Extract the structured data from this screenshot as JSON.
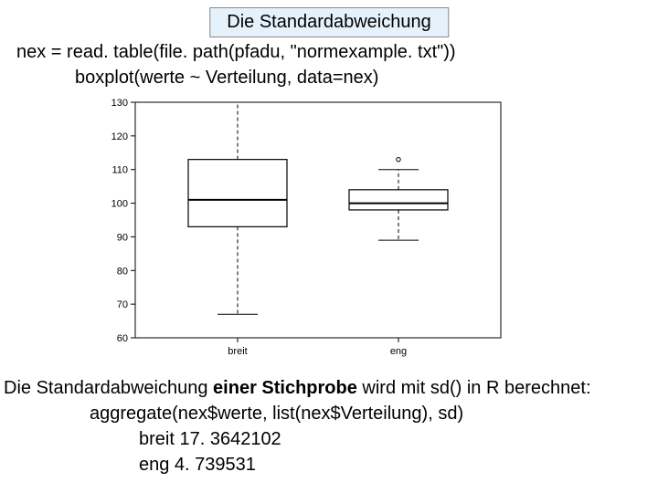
{
  "title": "Die Standardabweichung",
  "code": {
    "line1": "nex = read. table(file. path(pfadu, \"normexample. txt\"))",
    "line2": "boxplot(werte ~ Verteilung, data=nex)"
  },
  "below": {
    "line1_a": "Die Standardabweichung ",
    "line1_b": "einer Stichprobe",
    "line1_c": " wird mit sd() in R berechnet:",
    "line2": "aggregate(nex$werte, list(nex$Verteilung), sd)",
    "line3": "breit    17. 3642102",
    "line4": "eng                 4. 739531"
  },
  "chart_data": {
    "type": "boxplot",
    "title": "",
    "xlabel": "",
    "ylabel": "",
    "ylim": [
      60,
      130
    ],
    "yticks": [
      60,
      70,
      80,
      90,
      100,
      110,
      120,
      130
    ],
    "categories": [
      "breit",
      "eng"
    ],
    "series": [
      {
        "name": "breit",
        "min": 67,
        "q1": 93,
        "median": 101,
        "q3": 113,
        "max": 130
      },
      {
        "name": "eng",
        "min": 89,
        "q1": 98,
        "median": 100,
        "q3": 104,
        "max": 110,
        "outliers": [
          113
        ]
      }
    ]
  }
}
